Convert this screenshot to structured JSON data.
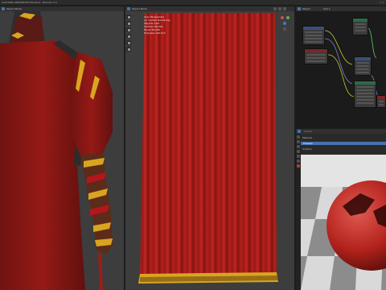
{
  "app": {
    "title": "CLOTHING PRESENTATION.blend - Blender 3.3"
  },
  "viewports": {
    "left": {
      "label": "Object Mode"
    },
    "center": {
      "label": "Object Mode",
      "overlay": [
        "User Perspective",
        "(1) Curtain Rendering",
        "Objects 1/24",
        "Vertices 98,304",
        "Faces 96,256",
        "Triangles 192,512"
      ]
    }
  },
  "node_editor": {
    "label": "Object",
    "tab": "Slot 1"
  },
  "properties": {
    "search_placeholder": "Search",
    "row_material": "Material",
    "row_preview": "Preview",
    "row_surface": "Surface"
  },
  "colors": {
    "accent": "#4772b3",
    "cloth": "#a01c18",
    "gold": "#d9a520"
  },
  "icons": [
    "move-icon",
    "rotate-icon",
    "scale-icon",
    "cursor-icon",
    "annotate-icon",
    "measure-icon",
    "camera-icon",
    "light-icon",
    "material-icon"
  ]
}
